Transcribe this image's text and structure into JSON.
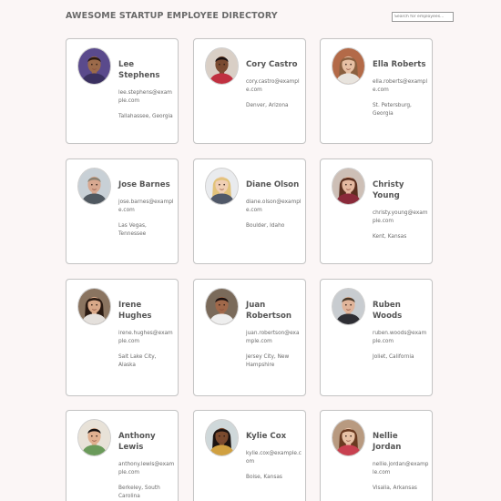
{
  "header": {
    "title": "AWESOME STARTUP EMPLOYEE DIRECTORY",
    "search_placeholder": "Search for employees..."
  },
  "employees": [
    {
      "name": "Lee Stephens",
      "email": "lee.stephens@example.com",
      "location": "Tallahassee, Georgia"
    },
    {
      "name": "Cory Castro",
      "email": "cory.castro@example.com",
      "location": "Denver, Arizona"
    },
    {
      "name": "Ella Roberts",
      "email": "ella.roberts@example.com",
      "location": "St. Petersburg, Georgia"
    },
    {
      "name": "Jose Barnes",
      "email": "jose.barnes@example.com",
      "location": "Las Vegas, Tennessee"
    },
    {
      "name": "Diane Olson",
      "email": "diane.olson@example.com",
      "location": "Boulder, Idaho"
    },
    {
      "name": "Christy Young",
      "email": "christy.young@example.com",
      "location": "Kent, Kansas"
    },
    {
      "name": "Irene Hughes",
      "email": "irene.hughes@example.com",
      "location": "Salt Lake City, Alaska"
    },
    {
      "name": "Juan Robertson",
      "email": "juan.robertson@example.com",
      "location": "Jersey City, New Hampshire"
    },
    {
      "name": "Ruben Woods",
      "email": "ruben.woods@example.com",
      "location": "Joliet, California"
    },
    {
      "name": "Anthony Lewis",
      "email": "anthony.lewis@example.com",
      "location": "Berkeley, South Carolina"
    },
    {
      "name": "Kylie Cox",
      "email": "kylie.cox@example.com",
      "location": "Boise, Kansas"
    },
    {
      "name": "Nellie Jordan",
      "email": "nellie.jordan@example.com",
      "location": "Visalia, Arkansas"
    }
  ]
}
